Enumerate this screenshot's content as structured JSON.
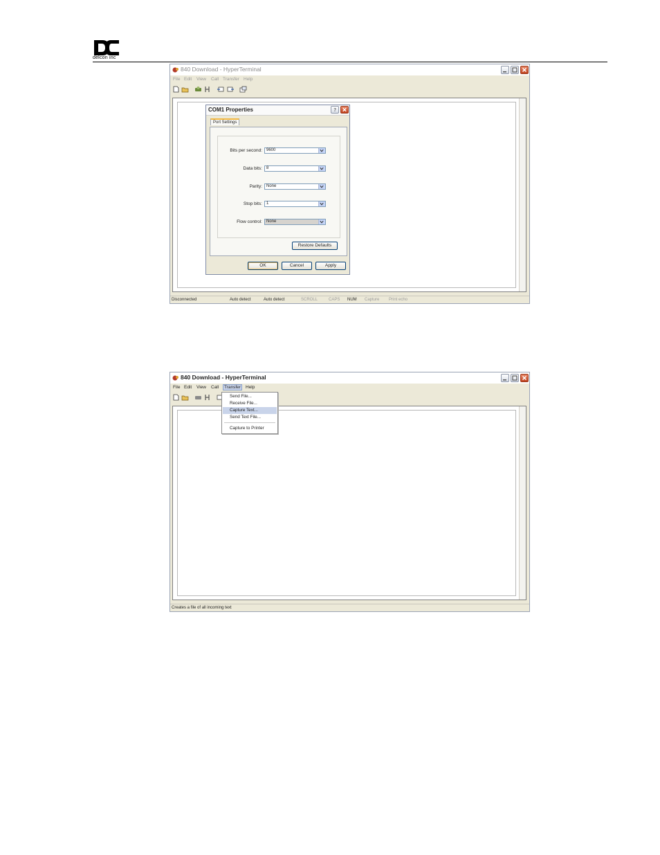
{
  "header": {
    "logo_text": "delcon inc"
  },
  "figure1": {
    "window_title": "840 Download - HyperTerminal",
    "menu": [
      "File",
      "Edit",
      "View",
      "Call",
      "Transfer",
      "Help"
    ],
    "dialog": {
      "title": "COM1 Properties",
      "tab": "Port Settings",
      "fields": [
        {
          "label": "Bits per second:",
          "value": "9600"
        },
        {
          "label": "Data bits:",
          "value": "8"
        },
        {
          "label": "Parity:",
          "value": "None"
        },
        {
          "label": "Stop bits:",
          "value": "1"
        },
        {
          "label": "Flow control:",
          "value": "None"
        }
      ],
      "restore_button": "Restore Defaults",
      "ok_button": "OK",
      "cancel_button": "Cancel",
      "apply_button": "Apply"
    },
    "status": [
      "Disconnected",
      "Auto detect",
      "Auto detect",
      "SCROLL",
      "CAPS",
      "NUM",
      "Capture",
      "Print echo"
    ]
  },
  "figure2": {
    "window_title": "840 Download - HyperTerminal",
    "menu": [
      "File",
      "Edit",
      "View",
      "Call",
      "Transfer",
      "Help"
    ],
    "transfer_menu": [
      "Send File...",
      "Receive File...",
      "Capture Text...",
      "Send Text File...",
      "Capture to Printer"
    ],
    "highlighted_item": "Capture Text...",
    "status": "Creates a file of all incoming text"
  },
  "colors": {
    "window_bg": "#ece9d8",
    "menu_highlight": "#c9d4ea",
    "close_button": "#c0401c"
  }
}
